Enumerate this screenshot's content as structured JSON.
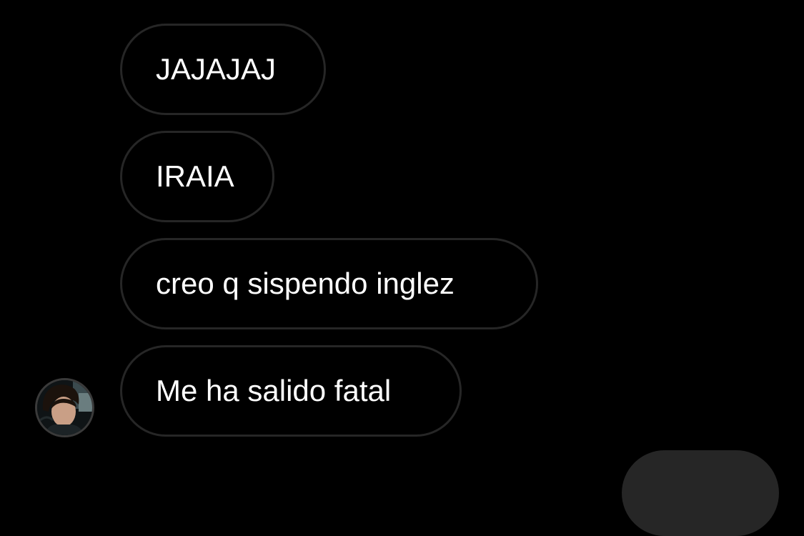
{
  "conversation": {
    "messages": [
      {
        "sender": "other",
        "text": "JAJAJAJ"
      },
      {
        "sender": "other",
        "text": "IRAIA"
      },
      {
        "sender": "other",
        "text": "creo q sispendo inglez"
      },
      {
        "sender": "other",
        "text": "Me ha salido fatal"
      }
    ],
    "sender_avatar": {
      "icon": "profile-photo"
    },
    "outgoing_partial": {
      "color": "#262626"
    }
  },
  "colors": {
    "background": "#000000",
    "bubble_border": "#262626",
    "text": "#ffffff"
  }
}
